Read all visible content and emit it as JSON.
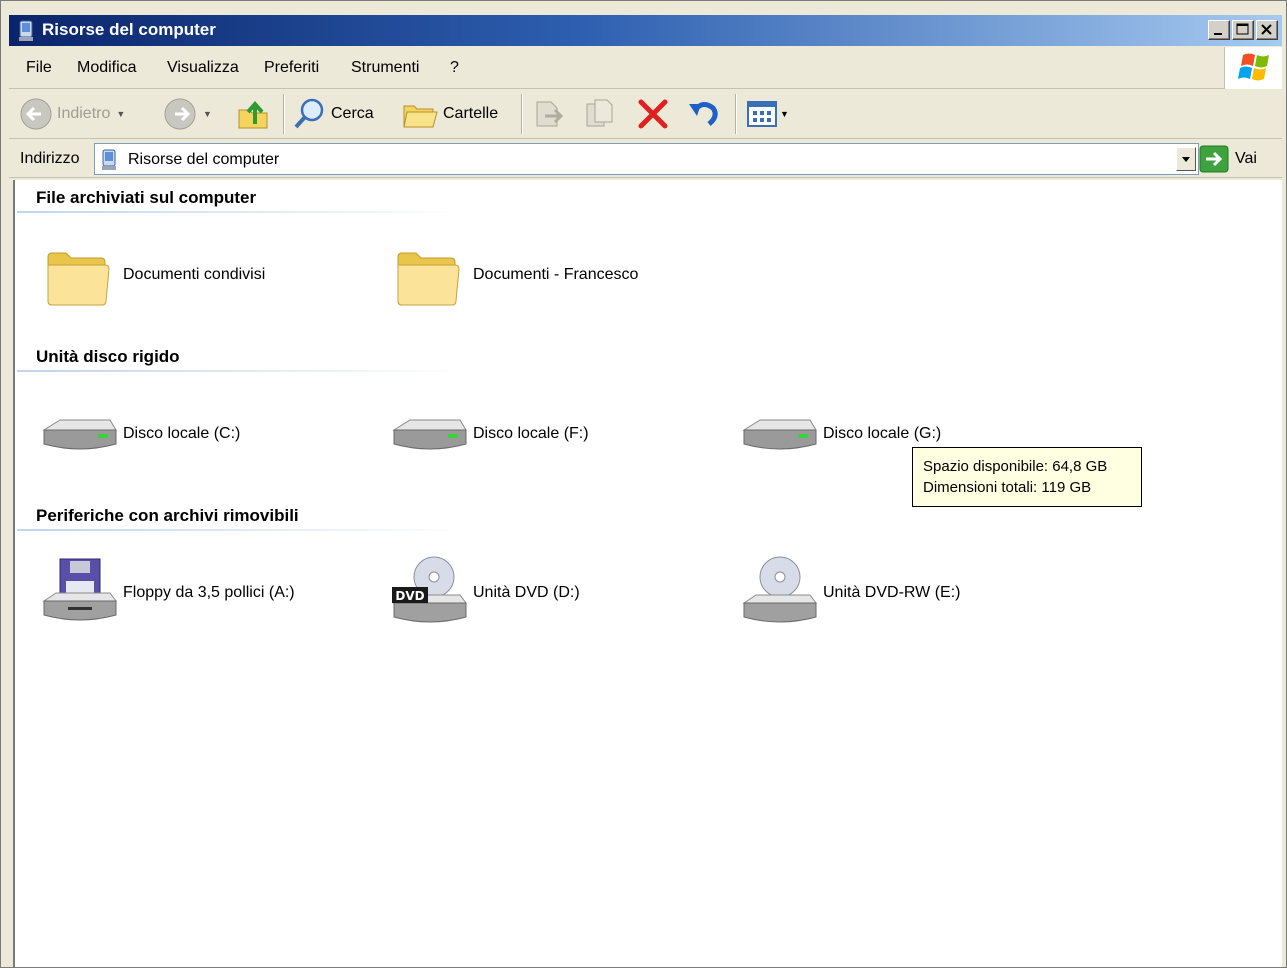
{
  "window": {
    "title": "Risorse del computer"
  },
  "menu": {
    "file": "File",
    "modifica": "Modifica",
    "visualizza": "Visualizza",
    "preferiti": "Preferiti",
    "strumenti": "Strumenti",
    "help": "?"
  },
  "toolbar": {
    "back_label": "Indietro",
    "search_label": "Cerca",
    "folders_label": "Cartelle"
  },
  "address": {
    "label": "Indirizzo",
    "value": "Risorse del computer",
    "go_label": "Vai"
  },
  "groups": [
    {
      "title": "File archiviati sul computer",
      "items": [
        {
          "name": "Documenti condivisi",
          "icon": "folder-icon"
        },
        {
          "name": "Documenti - Francesco",
          "icon": "folder-icon"
        }
      ]
    },
    {
      "title": "Unità disco rigido",
      "items": [
        {
          "name": "Disco locale (C:)",
          "icon": "hard-drive-icon"
        },
        {
          "name": "Disco locale (F:)",
          "icon": "hard-drive-icon"
        },
        {
          "name": "Disco locale (G:)",
          "icon": "hard-drive-icon"
        }
      ]
    },
    {
      "title": "Periferiche con archivi rimovibili",
      "items": [
        {
          "name": "Floppy da 3,5 pollici (A:)",
          "icon": "floppy-drive-icon"
        },
        {
          "name": "Unità DVD (D:)",
          "icon": "dvd-drive-icon",
          "badge": "DVD"
        },
        {
          "name": "Unità DVD-RW (E:)",
          "icon": "dvd-rw-drive-icon"
        }
      ]
    }
  ],
  "tooltip": {
    "line1": "Spazio disponibile: 64,8 GB",
    "line2": "Dimensioni totali: 119 GB"
  },
  "colors": {
    "titlebar_start": "#0a246a",
    "titlebar_end": "#a6caf0",
    "chrome": "#ece9d8",
    "tooltip_bg": "#ffffe1"
  }
}
